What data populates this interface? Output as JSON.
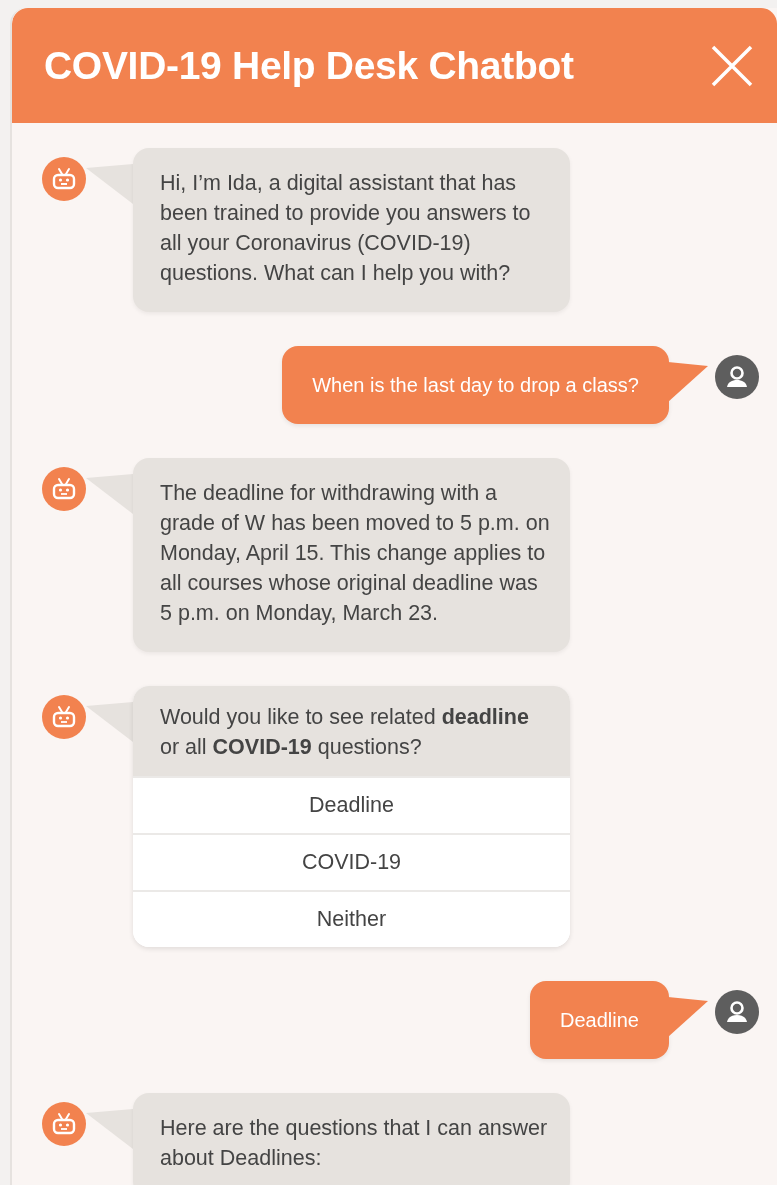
{
  "window": {
    "title": "COVID-19 Help Desk Chatbot"
  },
  "messages": [
    {
      "kind": "bot",
      "text": "Hi, I’m Ida, a digital assistant that has been trained to provide you answers to all your Coronavirus (COVID-19) questions. What can I help you with?"
    },
    {
      "kind": "user",
      "text": "When is the last day to drop a class?"
    },
    {
      "kind": "bot",
      "text": "The deadline for withdrawing with a grade of W has been moved to 5 p.m. on Monday, April 15. This change applies to all courses whose original deadline was 5 p.m. on Monday, March 23."
    },
    {
      "kind": "options",
      "text": "Would you like to see related **deadline** or all **COVID-19** questions?",
      "options": [
        "Deadline",
        "COVID-19",
        "Neither"
      ]
    },
    {
      "kind": "user",
      "text": "Deadline"
    },
    {
      "kind": "bot",
      "text": "Here are the questions that I can answer about Deadlines:"
    }
  ]
}
